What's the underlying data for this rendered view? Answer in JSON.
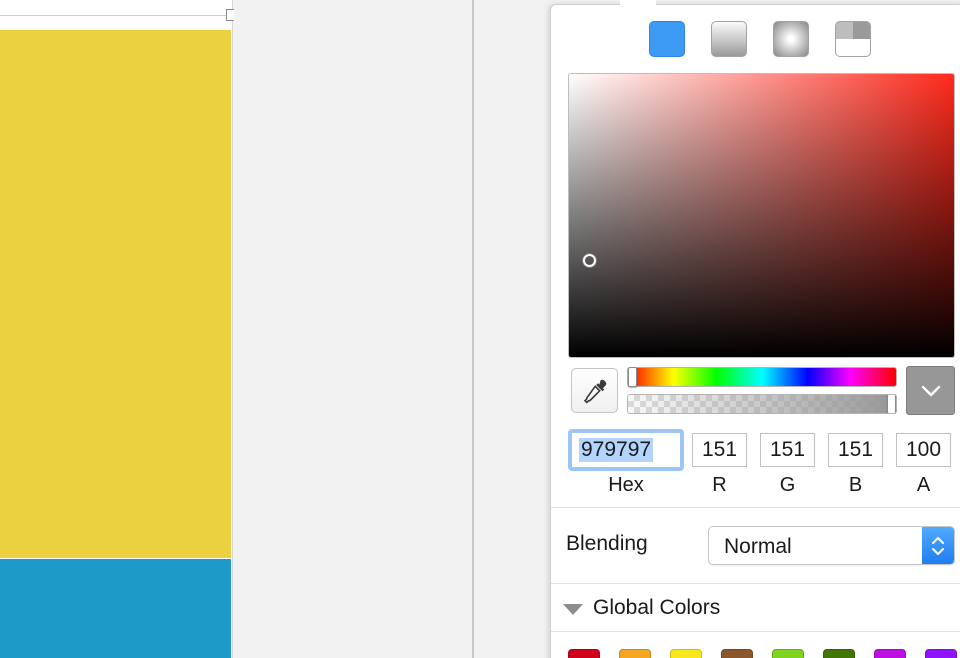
{
  "canvas": {
    "yellow_fill": "#ebd140",
    "blue_fill": "#1e9ac8"
  },
  "color_picker": {
    "fill_types": [
      {
        "name": "solid"
      },
      {
        "name": "linear-gradient"
      },
      {
        "name": "radial-gradient"
      },
      {
        "name": "angular-gradient"
      }
    ],
    "hue_color": "#ff2a1c",
    "current_color": "#979797",
    "hue_fraction": 0.0,
    "alpha_fraction": 1.0,
    "hex": "979797",
    "r": "151",
    "g": "151",
    "b": "151",
    "a": "100",
    "labels": {
      "hex": "Hex",
      "r": "R",
      "g": "G",
      "b": "B",
      "a": "A"
    },
    "blending_label": "Blending",
    "blending_value": "Normal",
    "global_colors_label": "Global Colors",
    "global_colors": [
      "#d0021b",
      "#f5a623",
      "#f8e71c",
      "#8b572a",
      "#7ed321",
      "#417505",
      "#bd10e0",
      "#9013fe"
    ]
  }
}
